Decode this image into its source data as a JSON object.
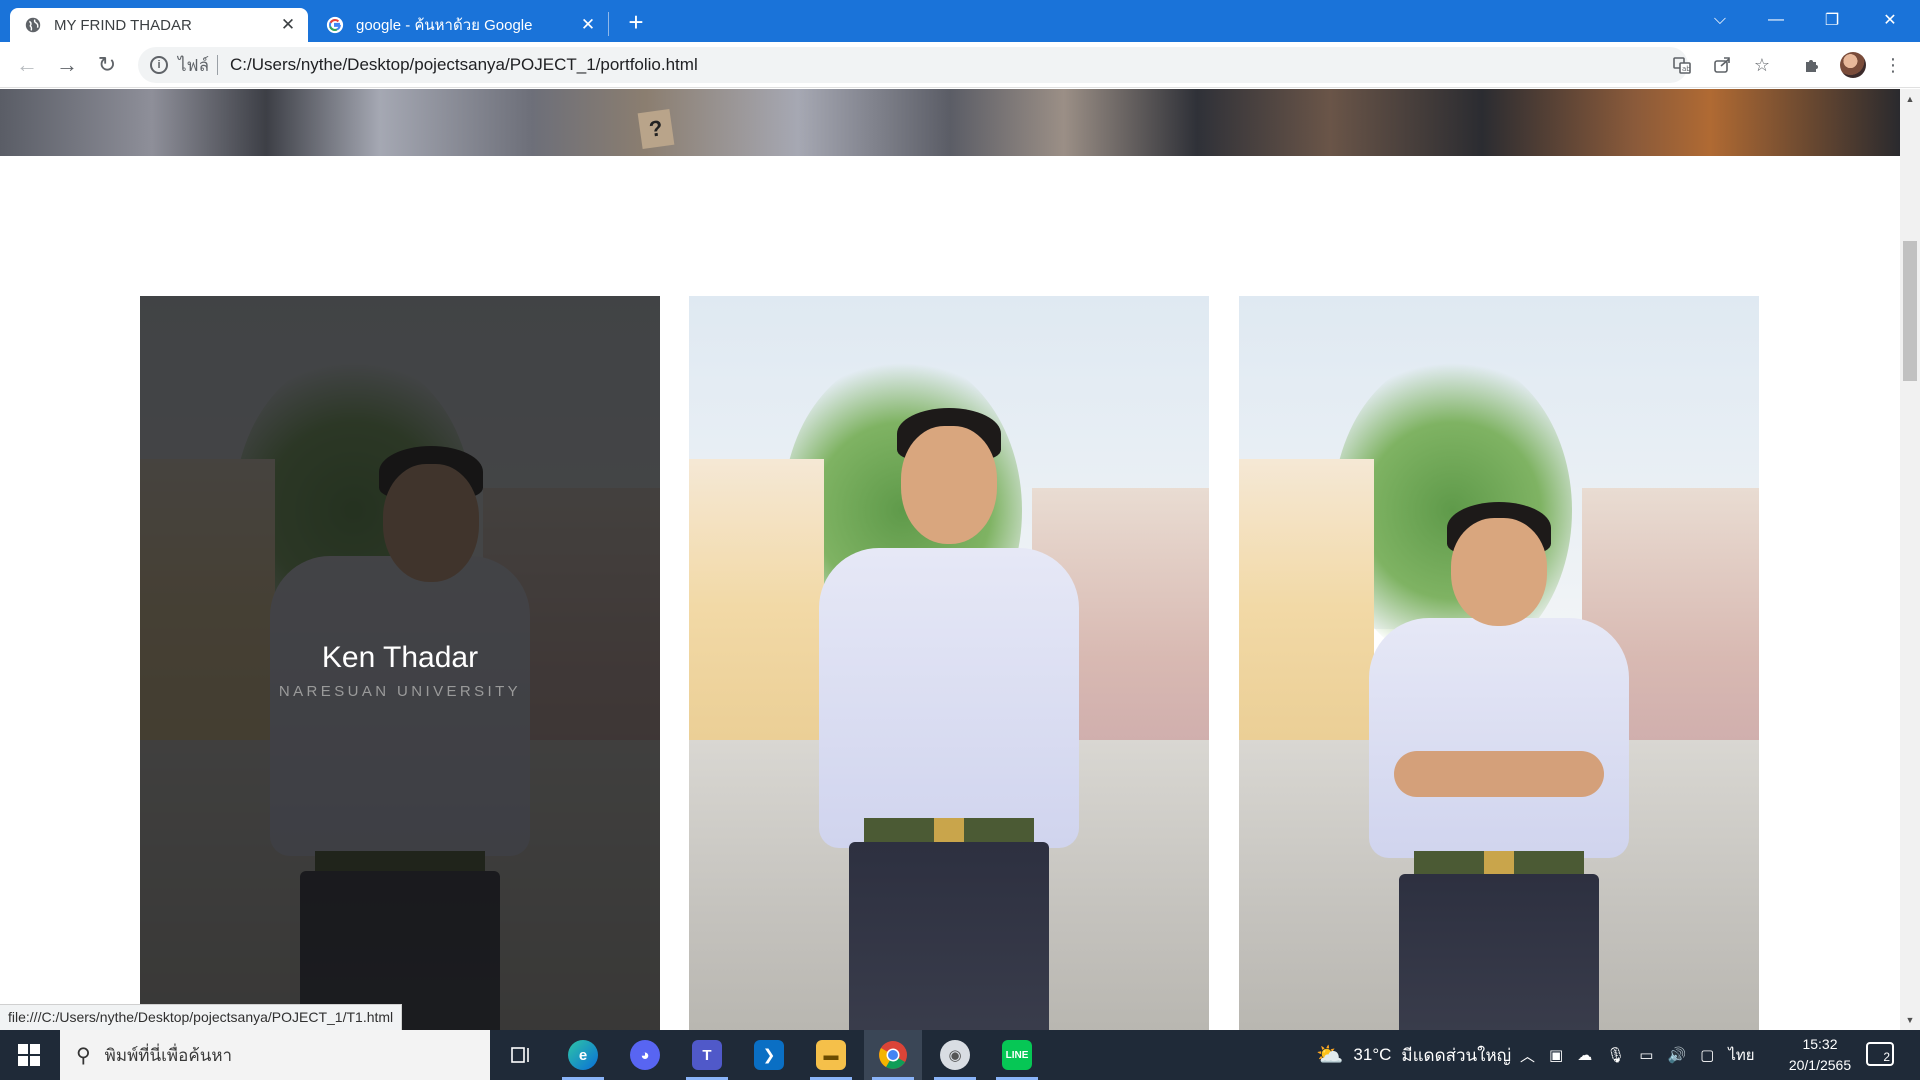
{
  "browser": {
    "tabs": [
      {
        "title": "MY FRIND THADAR",
        "active": true,
        "icon": "globe-icon"
      },
      {
        "title": "google - ค้นหาด้วย Google",
        "active": false,
        "icon": "google-g-icon"
      }
    ],
    "new_tab_label": "+",
    "address": {
      "scheme_label": "ไฟล์",
      "url": "C:/Users/nythe/Desktop/pojectsanya/POJECT_1/portfolio.html"
    },
    "status_url": "file:///C:/Users/nythe/Desktop/pojectsanya/POJECT_1/T1.html",
    "accent_color": "#1a73d9"
  },
  "page": {
    "cards": [
      {
        "name": "Ken Thadar",
        "subtitle": "NARESUAN UNIVERSITY",
        "hovered": true
      },
      {
        "name": "",
        "subtitle": "",
        "hovered": false
      },
      {
        "name": "",
        "subtitle": "",
        "hovered": false
      }
    ]
  },
  "taskbar": {
    "search_placeholder": "พิมพ์ที่นี่เพื่อค้นหา",
    "apps": [
      "task-view",
      "edge",
      "discord",
      "teams",
      "vscode",
      "file-explorer",
      "chrome",
      "media-player",
      "line"
    ],
    "weather": {
      "temp": "31°C",
      "desc": "มีแดดส่วนใหญ่"
    },
    "language": "ไทย",
    "time": "15:32",
    "date": "20/1/2565",
    "notification_count": "2"
  }
}
